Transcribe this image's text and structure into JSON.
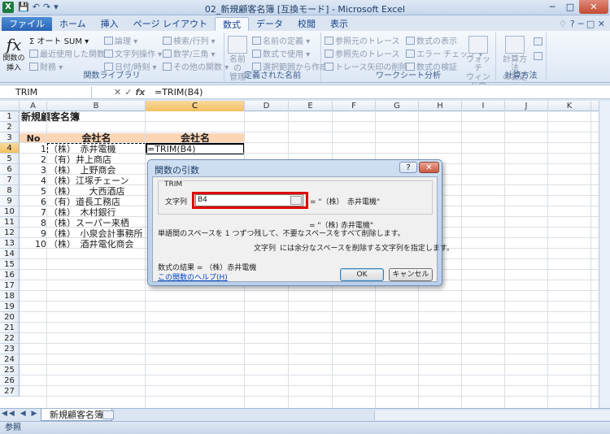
{
  "window": {
    "title": "02_新規顧客名簿 [互換モード] - Microsoft Excel",
    "app_icon": "X"
  },
  "qat": {
    "save": "💾",
    "undo": "↶",
    "redo": "↷",
    "customize": "▾"
  },
  "window_controls": {
    "minimize": "─",
    "maximize": "□",
    "close": "✕"
  },
  "tabs": [
    {
      "label": "ファイル"
    },
    {
      "label": "ホーム"
    },
    {
      "label": "挿入"
    },
    {
      "label": "ページ レイアウト"
    },
    {
      "label": "数式"
    },
    {
      "label": "データ"
    },
    {
      "label": "校閲"
    },
    {
      "label": "表示"
    }
  ],
  "tab_right": {
    "help": "♢",
    "min": "?",
    "controls": "─ □ ✕"
  },
  "ribbon": {
    "insert_function": "関数の\n挿入",
    "autosum": "Σ オート SUM ▾",
    "recent": "最近使用した関数 ▾",
    "financial": "財務 ▾",
    "logical": "論理 ▾",
    "text": "文字列操作 ▾",
    "datetime": "日付/時刻 ▾",
    "lookup": "検索/行列 ▾",
    "math": "数学/三角 ▾",
    "more": "その他の関数 ▾",
    "group1": "関数ライブラリ",
    "name_manager": "名前の\n管理",
    "define_name": "名前の定義 ▾",
    "use_in_formula": "数式で使用 ▾",
    "create_from_selection": "選択範囲から作成",
    "group2": "定義された名前",
    "trace_precedents": "参照元のトレース",
    "trace_dependents": "参照先のトレース",
    "remove_arrows": "トレース矢印の削除 ▾",
    "show_formulas": "数式の表示",
    "error_check": "エラー チェック ▾",
    "evaluate": "数式の検証",
    "watch": "ウォッチ\nウィンドウ",
    "group3": "ワークシート分析",
    "calc_options": "計算方法\nの設定 ▾",
    "group4": "計算方法"
  },
  "formula_bar": {
    "name_box": "TRIM",
    "fx": "fx",
    "formula": "=TRIM(B4)"
  },
  "columns": [
    "A",
    "B",
    "C",
    "D",
    "E",
    "F",
    "G",
    "H",
    "I",
    "J",
    "K"
  ],
  "rows": [
    "1",
    "2",
    "3",
    "4",
    "5",
    "6",
    "7",
    "8",
    "9",
    "10",
    "11",
    "12",
    "13",
    "14",
    "15",
    "16",
    "17",
    "18",
    "19",
    "20",
    "21",
    "22",
    "23",
    "24",
    "25",
    "26",
    "27"
  ],
  "cells": {
    "a1": "新規顧客名簿",
    "a3": "No",
    "b3": "会社名",
    "c3": "会社名",
    "c4": "=TRIM(B4)",
    "list": [
      {
        "no": "1",
        "name": "（株）　赤井電機"
      },
      {
        "no": "2",
        "name": "（有）井上商店"
      },
      {
        "no": "3",
        "name": "（株）　上野商会"
      },
      {
        "no": "4",
        "name": "（株）江塚チェーン"
      },
      {
        "no": "5",
        "name": "（株）　　大西酒店"
      },
      {
        "no": "6",
        "name": "（有）道長工務店"
      },
      {
        "no": "7",
        "name": "（株）　木村銀行"
      },
      {
        "no": "8",
        "name": "（株）スーパー来栖"
      },
      {
        "no": "9",
        "name": "（株）　小泉会計事務所"
      },
      {
        "no": "10",
        "name": "（株）　酒井電化商会"
      }
    ]
  },
  "sheet": {
    "nav": "◀◀ ◀ ▶ ▶▶",
    "tab": "新規顧客名簿"
  },
  "status": "参照",
  "dialog": {
    "title": "関数の引数",
    "help": "?",
    "close": "✕",
    "function": "TRIM",
    "arg_label": "文字列",
    "arg_value": "B4",
    "arg_result": "= \"（株）　赤井電機\"",
    "result_preview": "= \"（株) 赤井電機\"",
    "description": "単語間のスペースを 1 つずつ残して、不要なスペースをすべて削除します。",
    "arg_desc_name": "文字列",
    "arg_desc": "には余分なスペースを削除する文字列を指定します。",
    "formula_result": "数式の結果 = （株）赤井電機",
    "help_link": "この関数のヘルプ(H)",
    "ok": "OK",
    "cancel": "キャンセル"
  }
}
